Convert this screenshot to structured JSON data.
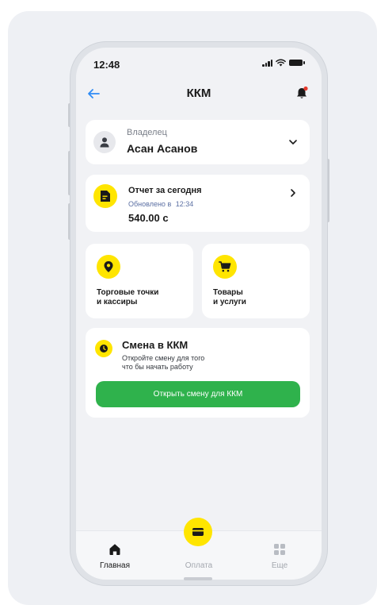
{
  "status_bar": {
    "time": "12:48"
  },
  "header": {
    "title": "ККМ"
  },
  "owner_card": {
    "role": "Владелец",
    "name": "Асан Асанов"
  },
  "report_card": {
    "title": "Отчет за сегодня",
    "updated_label": "Обновлено в",
    "updated_time": "12:34",
    "amount": "540.00 с"
  },
  "tiles": [
    {
      "line1": "Торговые точки",
      "line2": "и кассиры",
      "icon": "location-pin-icon"
    },
    {
      "line1": "Товары",
      "line2": "и услуги",
      "icon": "shopping-cart-icon"
    }
  ],
  "shift_card": {
    "title": "Смена в ККМ",
    "desc_line1": "Откройте смену для того",
    "desc_line2": "что бы начать работу",
    "button_label": "Открыть смену для ККМ"
  },
  "tabbar": {
    "items": [
      {
        "label": "Главная",
        "icon": "home-icon",
        "active": true
      },
      {
        "label": "Оплата",
        "icon": "card-icon",
        "active": false
      },
      {
        "label": "Еще",
        "icon": "grid-icon",
        "active": false
      }
    ]
  },
  "colors": {
    "accent_yellow": "#ffe500",
    "button_green": "#2fb24c",
    "back_arrow_blue": "#2f8cf5",
    "notification_red": "#e63b2e"
  }
}
